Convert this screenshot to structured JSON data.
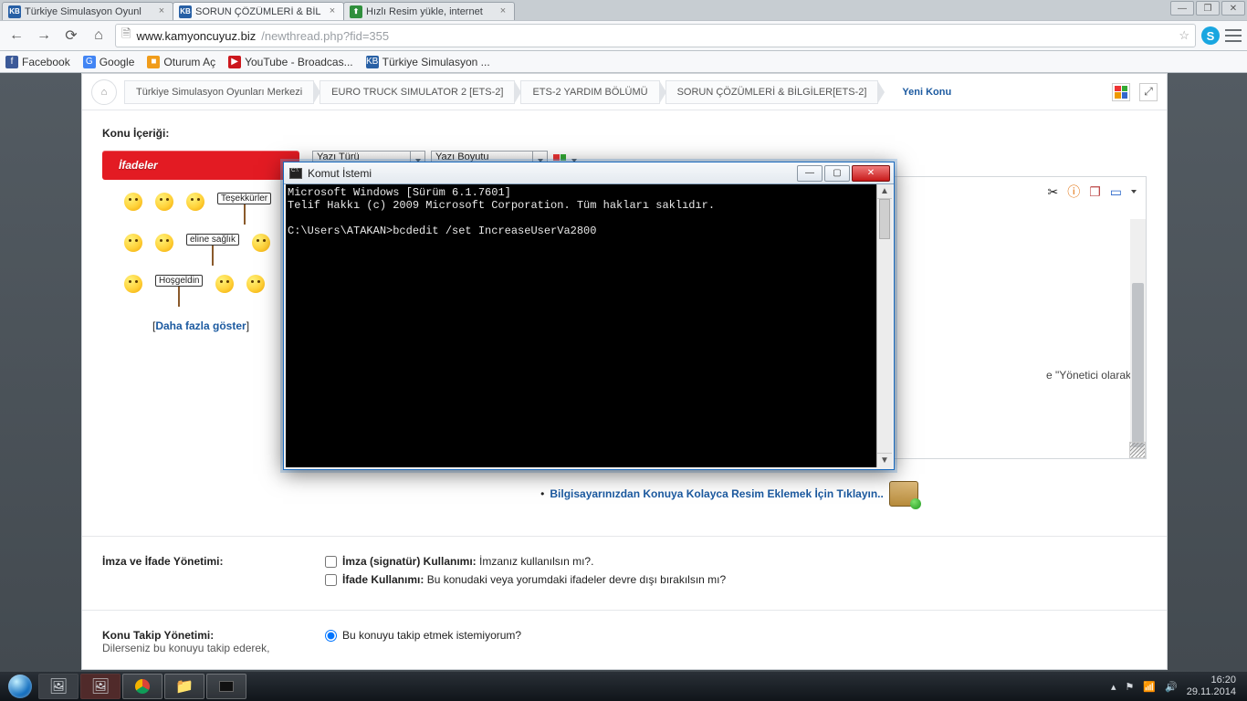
{
  "tabs": [
    {
      "title": "Türkiye Simulasyon Oyunl",
      "fav": "KB",
      "favcls": "",
      "active": false
    },
    {
      "title": "SORUN ÇÖZÜMLERİ & BİL",
      "fav": "KB",
      "favcls": "",
      "active": true
    },
    {
      "title": "Hızlı Resim yükle, internet",
      "fav": "⬆",
      "favcls": "green",
      "active": false
    }
  ],
  "winbtns": {
    "min": "—",
    "max": "❐",
    "close": "✕"
  },
  "toolbar": {
    "back": "←",
    "fwd": "→",
    "reload": "⟳",
    "home": "⌂",
    "doc": "🗎"
  },
  "url": {
    "host": "www.kamyoncuyuz.biz",
    "path": "/newthread.php?fid=355"
  },
  "bookmarks": [
    {
      "ico": "f",
      "cls": "fb",
      "label": "Facebook"
    },
    {
      "ico": "G",
      "cls": "gg",
      "label": "Google"
    },
    {
      "ico": "■",
      "cls": "or",
      "label": "Oturum Aç"
    },
    {
      "ico": "▶",
      "cls": "yt",
      "label": "YouTube - Broadcas..."
    },
    {
      "ico": "KB",
      "cls": "kb",
      "label": "Türkiye Simulasyon ..."
    }
  ],
  "breadcrumbs": [
    "Türkiye Simulasyon Oyunları Merkezi",
    "EURO TRUCK SIMULATOR 2 [ETS-2]",
    "ETS-2 YARDIM BÖLÜMÜ",
    "SORUN ÇÖZÜMLERİ & BİLGİLER[ETS-2]"
  ],
  "breadcrumb_current": "Yeni Konu",
  "section": {
    "title": "Konu İçeriği:",
    "ifadeler": "İfadeler",
    "show_more": "Daha fazla göster"
  },
  "signs": [
    "Teşekkürler",
    "eline sağlık",
    "Hoşgeldin"
  ],
  "selects": {
    "type": "Yazı Türü",
    "size": "Yazı Boyutu"
  },
  "editor_visible_text": "e \"Yönetici olarak",
  "addimage": "Bilgisayarınızdan Konuya Kolayca Resim Eklemek İçin Tıklayın..",
  "imza": {
    "title": "İmza ve İfade Yönetimi:",
    "opt1_label": "İmza (signatür) Kullanımı:",
    "opt1_text": "İmzanız kullanılsın mı?.",
    "opt2_label": "İfade Kullanımı:",
    "opt2_text": "Bu konudaki veya yorumdaki ifadeler devre dışı bırakılsın mı?"
  },
  "takip": {
    "title": "Konu Takip Yönetimi:",
    "sub": "Dilerseniz bu konuyu takip ederek,",
    "radio": "Bu konuyu takip etmek istemiyorum?"
  },
  "cmd": {
    "title": "Komut İstemi",
    "lines": [
      "Microsoft Windows [Sürüm 6.1.7601]",
      "Telif Hakkı (c) 2009 Microsoft Corporation. Tüm hakları saklıdır.",
      "",
      "C:\\Users\\ATAKAN>bcdedit /set IncreaseUserVa2800"
    ]
  },
  "tray": {
    "time": "16:20",
    "date": "29.11.2014"
  }
}
